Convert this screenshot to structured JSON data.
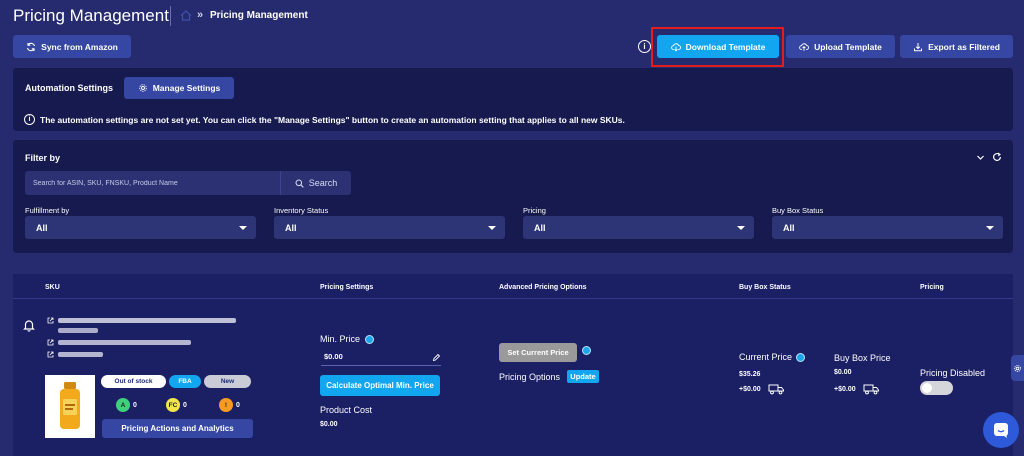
{
  "header": {
    "title": "Pricing Management",
    "breadcrumb_sep": "»",
    "breadcrumb": "Pricing Management"
  },
  "toolbar": {
    "sync_label": "Sync from Amazon",
    "info_glyph": "i",
    "download_label": "Download Template",
    "upload_label": "Upload Template",
    "export_label": "Export as Filtered"
  },
  "automation": {
    "title": "Automation Settings",
    "manage_label": "Manage Settings",
    "notice_glyph": "i",
    "notice": "The automation settings are not set yet. You can click the \"Manage Settings\" button to create an automation setting that applies to all new SKUs."
  },
  "filter": {
    "title": "Filter by",
    "search_placeholder": "Search for ASIN, SKU, FNSKU, Product Name",
    "search_label": "Search",
    "fields": [
      {
        "label": "Fulfillment by",
        "value": "All"
      },
      {
        "label": "Inventory Status",
        "value": "All"
      },
      {
        "label": "Pricing",
        "value": "All"
      },
      {
        "label": "Buy Box Status",
        "value": "All"
      }
    ]
  },
  "table": {
    "headers": [
      "SKU",
      "Pricing Settings",
      "Advanced Pricing Options",
      "Buy Box Status",
      "Pricing"
    ],
    "row": {
      "badges": {
        "stock": "Out of stock",
        "fba": "FBA",
        "new": "New"
      },
      "ratings": [
        {
          "letter": "A",
          "count": "0",
          "color": "#3fd17a"
        },
        {
          "letter": "FC",
          "count": "0",
          "color": "#f2e64a"
        },
        {
          "letter": "!",
          "count": "0",
          "color": "#f59a23"
        }
      ],
      "actions_label": "Pricing Actions and Analytics",
      "min_price_label": "Min. Price",
      "min_price_value": "$0.00",
      "calc_label": "Calculate Optimal Min. Price",
      "product_cost_label": "Product Cost",
      "product_cost_value": "$0.00",
      "set_current_label": "Set Current Price",
      "pricing_options_label": "Pricing Options",
      "update_label": "Update",
      "current_price_label": "Current Price",
      "current_price_value": "$35.26",
      "current_price_shipping": "+$0.00",
      "buybox_price_label": "Buy Box Price",
      "buybox_price_value": "$0.00",
      "buybox_price_shipping": "+$0.00",
      "pricing_status": "Pricing Disabled"
    }
  },
  "colors": {
    "background": "#262a6e",
    "panel": "#161a4e",
    "accent": "#1aa3f0",
    "button": "#3546a3",
    "highlight": "#e31c1c"
  }
}
